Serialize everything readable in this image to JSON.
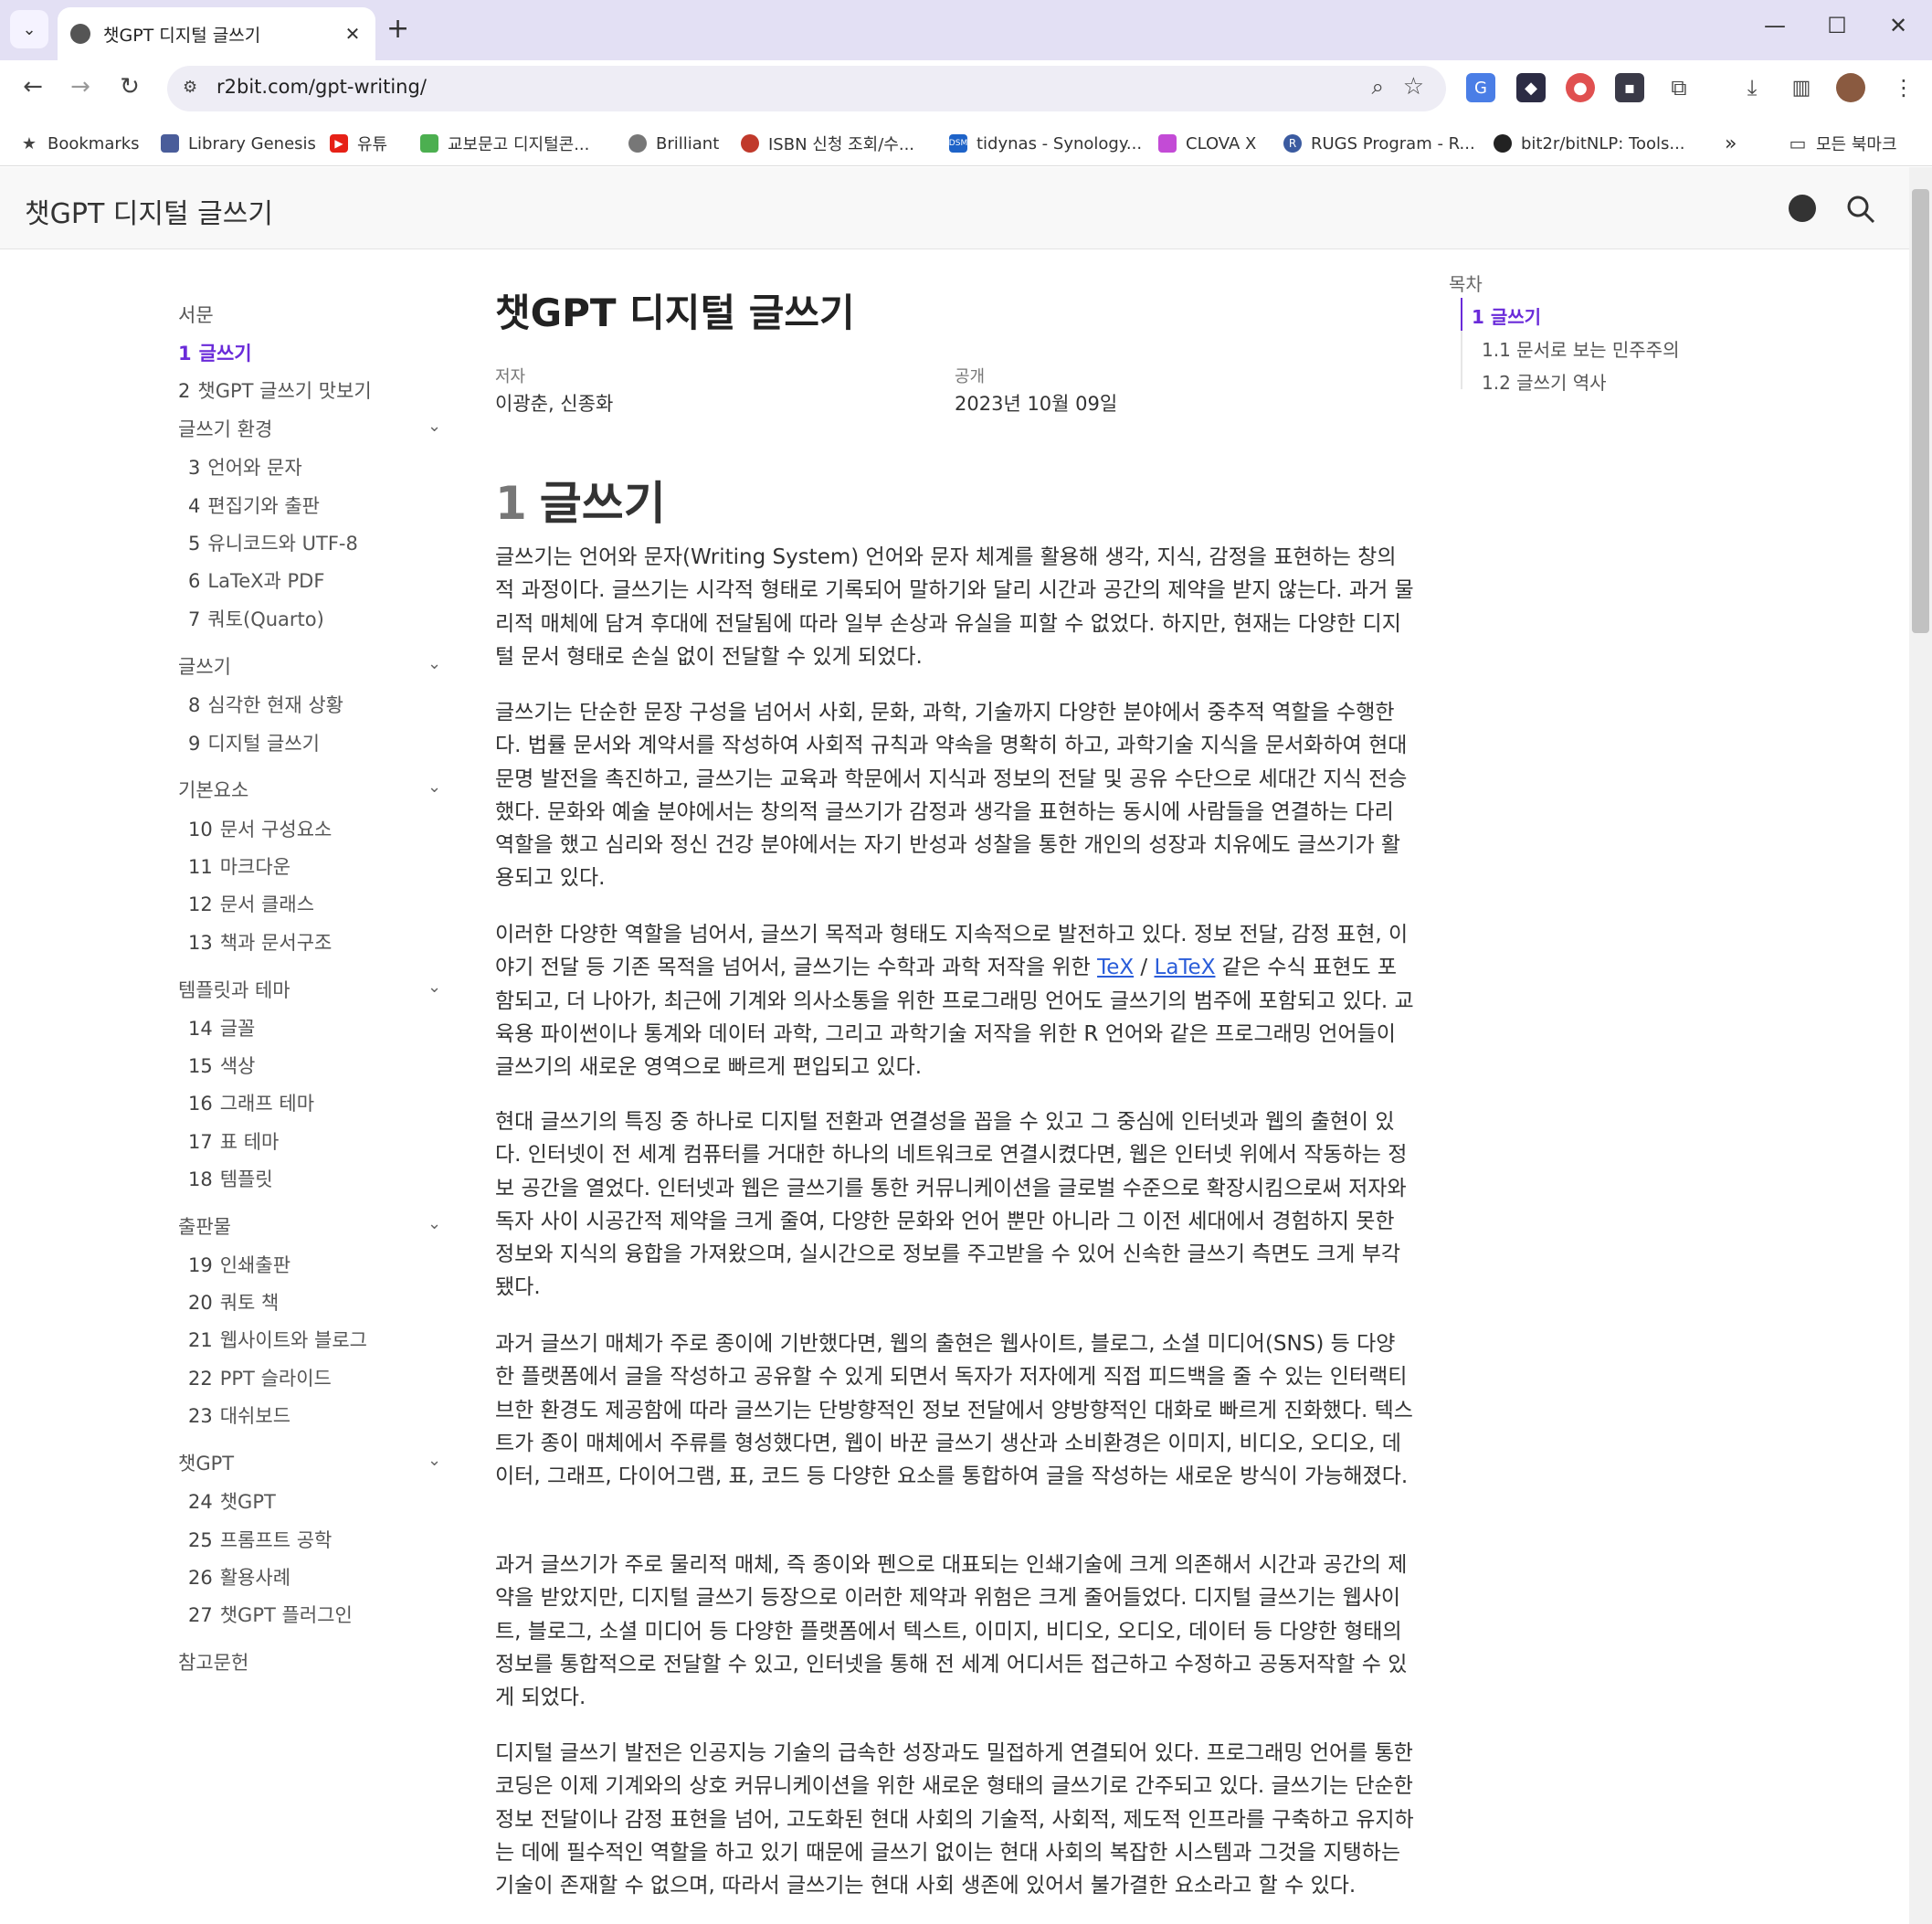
{
  "browser": {
    "tab_title": "챗GPT 디지털 글쓰기",
    "url": "r2bit.com/gpt-writing/",
    "bookmarks": [
      {
        "label": "Bookmarks",
        "icon": "star-icon"
      },
      {
        "label": "Library Genesis",
        "icon": "library-icon"
      },
      {
        "label": "유튜",
        "icon": "youtube-icon"
      },
      {
        "label": "교보문고 디지털콘...",
        "icon": "kyobo-icon"
      },
      {
        "label": "Brilliant",
        "icon": "brilliant-icon"
      },
      {
        "label": "ISBN 신청 조회/수...",
        "icon": "isbn-icon"
      },
      {
        "label": "tidynas - Synology...",
        "icon": "synology-icon"
      },
      {
        "label": "CLOVA X",
        "icon": "clova-icon"
      },
      {
        "label": "RUGS Program - R...",
        "icon": "rugs-icon"
      },
      {
        "label": "bit2r/bitNLP: Tools...",
        "icon": "github-icon"
      }
    ],
    "all_bookmarks": "모든 북마크",
    "more_bookmarks": "»"
  },
  "site": {
    "title": "챗GPT 디지털 글쓰기"
  },
  "sidebar": {
    "intro": "서문",
    "items": [
      {
        "num": "1",
        "label": "글쓰기",
        "active": true
      },
      {
        "num": "2",
        "label": "챗GPT 글쓰기 맛보기"
      }
    ],
    "sections": [
      {
        "title": "글쓰기 환경",
        "items": [
          {
            "num": "3",
            "label": "언어와 문자"
          },
          {
            "num": "4",
            "label": "편집기와 출판"
          },
          {
            "num": "5",
            "label": "유니코드와 UTF-8"
          },
          {
            "num": "6",
            "label": "LaTeX과 PDF"
          },
          {
            "num": "7",
            "label": "쿼토(Quarto)"
          }
        ]
      },
      {
        "title": "글쓰기",
        "items": [
          {
            "num": "8",
            "label": "심각한 현재 상황"
          },
          {
            "num": "9",
            "label": "디지털 글쓰기"
          }
        ]
      },
      {
        "title": "기본요소",
        "items": [
          {
            "num": "10",
            "label": "문서 구성요소"
          },
          {
            "num": "11",
            "label": "마크다운"
          },
          {
            "num": "12",
            "label": "문서 클래스"
          },
          {
            "num": "13",
            "label": "책과 문서구조"
          }
        ]
      },
      {
        "title": "템플릿과 테마",
        "items": [
          {
            "num": "14",
            "label": "글꼴"
          },
          {
            "num": "15",
            "label": "색상"
          },
          {
            "num": "16",
            "label": "그래프 테마"
          },
          {
            "num": "17",
            "label": "표 테마"
          },
          {
            "num": "18",
            "label": "템플릿"
          }
        ]
      },
      {
        "title": "출판물",
        "items": [
          {
            "num": "19",
            "label": "인쇄출판"
          },
          {
            "num": "20",
            "label": "쿼토 책"
          },
          {
            "num": "21",
            "label": "웹사이트와 블로그"
          },
          {
            "num": "22",
            "label": "PPT 슬라이드"
          },
          {
            "num": "23",
            "label": "대쉬보드"
          }
        ]
      },
      {
        "title": "챗GPT",
        "items": [
          {
            "num": "24",
            "label": "챗GPT"
          },
          {
            "num": "25",
            "label": "프롬프트 공학"
          },
          {
            "num": "26",
            "label": "활용사례"
          },
          {
            "num": "27",
            "label": "챗GPT 플러그인"
          }
        ]
      }
    ],
    "references": "참고문헌"
  },
  "main": {
    "title": "챗GPT 디지털 글쓰기",
    "author_label": "저자",
    "author": "이광춘, 신종화",
    "published_label": "공개",
    "published": "2023년 10월 09일",
    "section_num": "1",
    "section_title": "글쓰기",
    "paragraphs": [
      "글쓰기는 언어와 문자(Writing System) 언어와 문자 체계를 활용해 생각, 지식, 감정을 표현하는 창의적 과정이다. 글쓰기는 시각적 형태로 기록되어 말하기와 달리 시간과 공간의 제약을 받지 않는다. 과거 물리적 매체에 담겨 후대에 전달됨에 따라 일부 손상과 유실을 피할 수 없었다. 하지만, 현재는 다양한 디지털 문서 형태로 손실 없이 전달할 수 있게 되었다.",
      "글쓰기는 단순한 문장 구성을 넘어서 사회, 문화, 과학, 기술까지 다양한 분야에서 중추적 역할을 수행한다. 법률 문서와 계약서를 작성하여 사회적 규칙과 약속을 명확히 하고, 과학기술 지식을 문서화하여 현대 문명 발전을 촉진하고, 글쓰기는 교육과 학문에서 지식과 정보의 전달 및 공유 수단으로 세대간 지식 전승했다. 문화와 예술 분야에서는 창의적 글쓰기가 감정과 생각을 표현하는 동시에 사람들을 연결하는 다리 역할을 했고 심리와 정신 건강 분야에서는 자기 반성과 성찰을 통한 개인의 성장과 치유에도 글쓰기가 활용되고 있다.",
      {
        "before": "이러한 다양한 역할을 넘어서, 글쓰기 목적과 형태도 지속적으로 발전하고 있다. 정보 전달, 감정 표현, 이야기 전달 등 기존 목적을 넘어서, 글쓰기는 수학과 과학 저작을 위한 ",
        "link1": "TeX",
        "sep": " / ",
        "link2": "LaTeX",
        "after": " 같은 수식 표현도 포함되고, 더 나아가, 최근에 기계와 의사소통을 위한 프로그래밍 언어도 글쓰기의 범주에 포함되고 있다. 교육용 파이썬이나 통계와 데이터 과학, 그리고 과학기술 저작을 위한 R 언어와 같은 프로그래밍 언어들이 글쓰기의 새로운 영역으로 빠르게 편입되고 있다."
      },
      "현대 글쓰기의 특징 중 하나로 디지털 전환과 연결성을 꼽을 수 있고 그 중심에 인터넷과 웹의 출현이 있다. 인터넷이 전 세계 컴퓨터를 거대한 하나의 네트워크로 연결시켰다면, 웹은 인터넷 위에서 작동하는 정보 공간을 열었다. 인터넷과 웹은 글쓰기를 통한 커뮤니케이션을 글로벌 수준으로 확장시킴으로써 저자와 독자 사이 시공간적 제약을 크게 줄여, 다양한 문화와 언어 뿐만 아니라 그 이전 세대에서 경험하지 못한 정보와 지식의 융합을 가져왔으며, 실시간으로 정보를 주고받을 수 있어 신속한 글쓰기 측면도 크게 부각됐다.",
      "과거 글쓰기 매체가 주로 종이에 기반했다면, 웹의 출현은 웹사이트, 블로그, 소셜 미디어(SNS) 등 다양한 플랫폼에서 글을 작성하고 공유할 수 있게 되면서 독자가 저자에게 직접 피드백을 줄 수 있는 인터랙티브한 환경도 제공함에 따라 글쓰기는 단방향적인 정보 전달에서 양방향적인 대화로 빠르게 진화했다. 텍스트가 종이 매체에서 주류를 형성했다면, 웹이 바꾼 글쓰기 생산과 소비환경은 이미지, 비디오, 오디오, 데이터, 그래프, 다이어그램, 표, 코드 등 다양한 요소를 통합하여 글을 작성하는 새로운 방식이 가능해졌다.",
      "과거 글쓰기가 주로 물리적 매체, 즉 종이와 펜으로 대표되는 인쇄기술에 크게 의존해서 시간과 공간의 제약을 받았지만, 디지털 글쓰기 등장으로 이러한 제약과 위험은 크게 줄어들었다. 디지털 글쓰기는 웹사이트, 블로그, 소셜 미디어 등 다양한 플랫폼에서 텍스트, 이미지, 비디오, 오디오, 데이터 등 다양한 형태의 정보를 통합적으로 전달할 수 있고, 인터넷을 통해 전 세계 어디서든 접근하고 수정하고 공동저작할 수 있게 되었다.",
      "디지털 글쓰기 발전은 인공지능 기술의 급속한 성장과도 밀접하게 연결되어 있다. 프로그래밍 언어를 통한 코딩은 이제 기계와의 상호 커뮤니케이션을 위한 새로운 형태의 글쓰기로 간주되고 있다. 글쓰기는 단순한 정보 전달이나 감정 표현을 넘어, 고도화된 현대 사회의 기술적, 사회적, 제도적 인프라를 구축하고 유지하는 데에 필수적인 역할을 하고 있기 때문에 글쓰기 없이는 현대 사회의 복잡한 시스템과 그것을 지탱하는 기술이 존재할 수 없으며, 따라서 글쓰기는 현대 사회 생존에 있어서 불가결한 요소라고 할 수 있다."
    ]
  },
  "toc": {
    "heading": "목차",
    "items": [
      {
        "label": "1 글쓰기",
        "active": true
      },
      {
        "label": "1.1 문서로 보는 민주주의"
      },
      {
        "label": "1.2 글쓰기 역사"
      }
    ]
  }
}
